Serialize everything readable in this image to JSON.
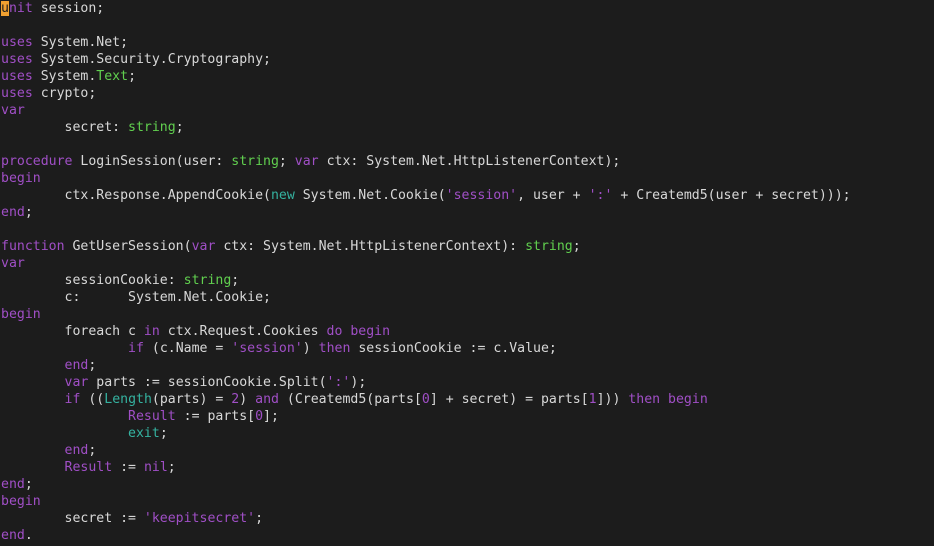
{
  "editor": {
    "file_content_language": "pascal",
    "colors": {
      "background": "#1c1c1c",
      "default": "#d8d8d8",
      "keyword": "#a04fc6",
      "type": "#61d04f",
      "string": "#a04fc6",
      "number": "#a04fc6",
      "builtin": "#35b2a0",
      "cursor": "#f0a030"
    },
    "lines": [
      [
        {
          "t": "u",
          "c": "cursor"
        },
        {
          "t": "nit",
          "c": "keyword"
        },
        {
          "t": " session;",
          "c": "default"
        }
      ],
      [],
      [
        {
          "t": "uses",
          "c": "keyword"
        },
        {
          "t": " System.Net;",
          "c": "default"
        }
      ],
      [
        {
          "t": "uses",
          "c": "keyword"
        },
        {
          "t": " System.Security.Cryptography;",
          "c": "default"
        }
      ],
      [
        {
          "t": "uses",
          "c": "keyword"
        },
        {
          "t": " System.",
          "c": "default"
        },
        {
          "t": "Text",
          "c": "type"
        },
        {
          "t": ";",
          "c": "default"
        }
      ],
      [
        {
          "t": "uses",
          "c": "keyword"
        },
        {
          "t": " crypto;",
          "c": "default"
        }
      ],
      [
        {
          "t": "var",
          "c": "keyword"
        }
      ],
      [
        {
          "t": "        secret: ",
          "c": "default"
        },
        {
          "t": "string",
          "c": "type"
        },
        {
          "t": ";",
          "c": "default"
        }
      ],
      [],
      [
        {
          "t": "procedure",
          "c": "keyword"
        },
        {
          "t": " LoginSession(user: ",
          "c": "default"
        },
        {
          "t": "string",
          "c": "type"
        },
        {
          "t": "; ",
          "c": "default"
        },
        {
          "t": "var",
          "c": "keyword"
        },
        {
          "t": " ctx: System.Net.HttpListenerContext);",
          "c": "default"
        }
      ],
      [
        {
          "t": "begin",
          "c": "keyword"
        }
      ],
      [
        {
          "t": "        ctx.Response.AppendCookie(",
          "c": "default"
        },
        {
          "t": "new",
          "c": "builtin"
        },
        {
          "t": " System.Net.Cookie(",
          "c": "default"
        },
        {
          "t": "'session'",
          "c": "string"
        },
        {
          "t": ", user + ",
          "c": "default"
        },
        {
          "t": "':'",
          "c": "string"
        },
        {
          "t": " + Createmd5(user + secret)));",
          "c": "default"
        }
      ],
      [
        {
          "t": "end",
          "c": "keyword"
        },
        {
          "t": ";",
          "c": "default"
        }
      ],
      [],
      [
        {
          "t": "function",
          "c": "keyword"
        },
        {
          "t": " GetUserSession(",
          "c": "default"
        },
        {
          "t": "var",
          "c": "keyword"
        },
        {
          "t": " ctx: System.Net.HttpListenerContext): ",
          "c": "default"
        },
        {
          "t": "string",
          "c": "type"
        },
        {
          "t": ";",
          "c": "default"
        }
      ],
      [
        {
          "t": "var",
          "c": "keyword"
        }
      ],
      [
        {
          "t": "        sessionCookie: ",
          "c": "default"
        },
        {
          "t": "string",
          "c": "type"
        },
        {
          "t": ";",
          "c": "default"
        }
      ],
      [
        {
          "t": "        c:      System.Net.Cookie;",
          "c": "default"
        }
      ],
      [
        {
          "t": "begin",
          "c": "keyword"
        }
      ],
      [
        {
          "t": "        foreach c ",
          "c": "default"
        },
        {
          "t": "in",
          "c": "keyword"
        },
        {
          "t": " ctx.Request.Cookies ",
          "c": "default"
        },
        {
          "t": "do begin",
          "c": "keyword"
        }
      ],
      [
        {
          "t": "                ",
          "c": "default"
        },
        {
          "t": "if",
          "c": "keyword"
        },
        {
          "t": " (c.Name = ",
          "c": "default"
        },
        {
          "t": "'session'",
          "c": "string"
        },
        {
          "t": ") ",
          "c": "default"
        },
        {
          "t": "then",
          "c": "keyword"
        },
        {
          "t": " sessionCookie := c.Value;",
          "c": "default"
        }
      ],
      [
        {
          "t": "        ",
          "c": "default"
        },
        {
          "t": "end",
          "c": "keyword"
        },
        {
          "t": ";",
          "c": "default"
        }
      ],
      [
        {
          "t": "        ",
          "c": "default"
        },
        {
          "t": "var",
          "c": "keyword"
        },
        {
          "t": " parts := sessionCookie.Split(",
          "c": "default"
        },
        {
          "t": "':'",
          "c": "string"
        },
        {
          "t": ");",
          "c": "default"
        }
      ],
      [
        {
          "t": "        ",
          "c": "default"
        },
        {
          "t": "if",
          "c": "keyword"
        },
        {
          "t": " ((",
          "c": "default"
        },
        {
          "t": "Length",
          "c": "builtin"
        },
        {
          "t": "(parts) = ",
          "c": "default"
        },
        {
          "t": "2",
          "c": "number"
        },
        {
          "t": ") ",
          "c": "default"
        },
        {
          "t": "and",
          "c": "keyword"
        },
        {
          "t": " (Createmd5(parts[",
          "c": "default"
        },
        {
          "t": "0",
          "c": "number"
        },
        {
          "t": "] + secret) = parts[",
          "c": "default"
        },
        {
          "t": "1",
          "c": "number"
        },
        {
          "t": "])) ",
          "c": "default"
        },
        {
          "t": "then begin",
          "c": "keyword"
        }
      ],
      [
        {
          "t": "                ",
          "c": "default"
        },
        {
          "t": "Result",
          "c": "keyword"
        },
        {
          "t": " := parts[",
          "c": "default"
        },
        {
          "t": "0",
          "c": "number"
        },
        {
          "t": "];",
          "c": "default"
        }
      ],
      [
        {
          "t": "                ",
          "c": "default"
        },
        {
          "t": "exit",
          "c": "builtin"
        },
        {
          "t": ";",
          "c": "default"
        }
      ],
      [
        {
          "t": "        ",
          "c": "default"
        },
        {
          "t": "end",
          "c": "keyword"
        },
        {
          "t": ";",
          "c": "default"
        }
      ],
      [
        {
          "t": "        ",
          "c": "default"
        },
        {
          "t": "Result",
          "c": "keyword"
        },
        {
          "t": " := ",
          "c": "default"
        },
        {
          "t": "nil",
          "c": "keyword"
        },
        {
          "t": ";",
          "c": "default"
        }
      ],
      [
        {
          "t": "end",
          "c": "keyword"
        },
        {
          "t": ";",
          "c": "default"
        }
      ],
      [
        {
          "t": "begin",
          "c": "keyword"
        }
      ],
      [
        {
          "t": "        secret := ",
          "c": "default"
        },
        {
          "t": "'keepitsecret'",
          "c": "string"
        },
        {
          "t": ";",
          "c": "default"
        }
      ],
      [
        {
          "t": "end",
          "c": "keyword"
        },
        {
          "t": ".",
          "c": "default"
        }
      ]
    ]
  }
}
